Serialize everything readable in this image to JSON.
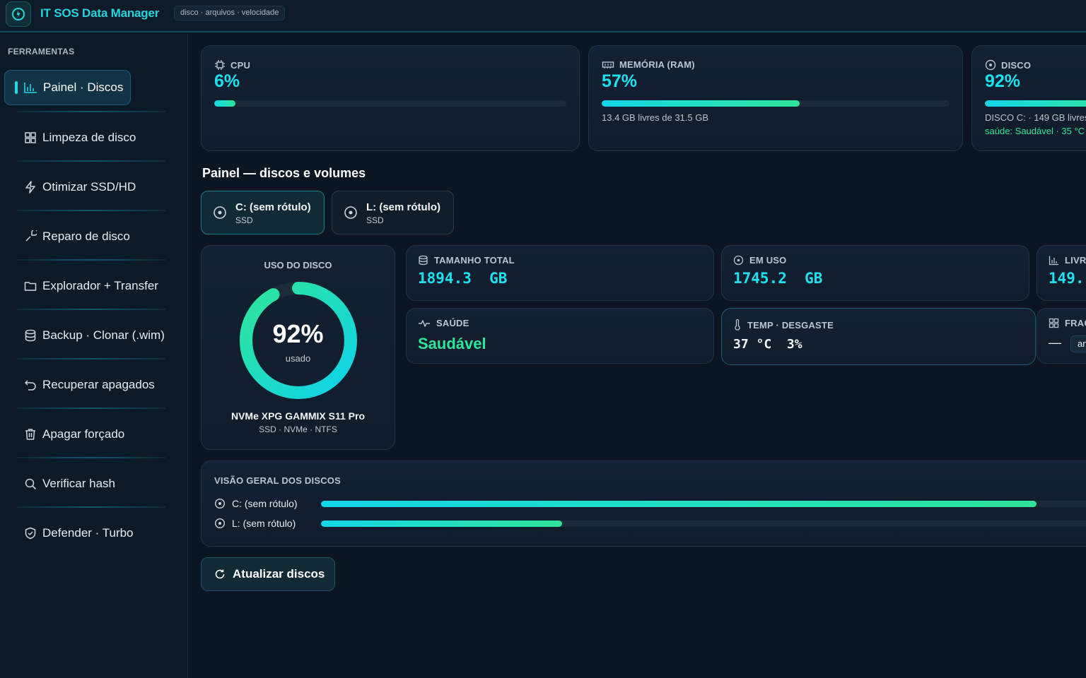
{
  "app": {
    "title": "IT SOS Data Manager",
    "tagline": "disco · arquivos · velocidade"
  },
  "sidebar": {
    "section_title": "FERRAMENTAS",
    "items": [
      {
        "label": "Painel · Discos",
        "icon": "bar-chart-icon",
        "active": true
      },
      {
        "label": "Limpeza de disco",
        "icon": "grid-icon"
      },
      {
        "label": "Otimizar SSD/HD",
        "icon": "lightning-icon"
      },
      {
        "label": "Reparo de disco",
        "icon": "wrench-icon"
      },
      {
        "label": "Explorador + Transfer",
        "icon": "folder-icon"
      },
      {
        "label": "Backup · Clonar (.wim)",
        "icon": "database-icon"
      },
      {
        "label": "Recuperar apagados",
        "icon": "undo-icon"
      },
      {
        "label": "Apagar forçado",
        "icon": "trash-icon"
      },
      {
        "label": "Verificar hash",
        "icon": "search-icon"
      },
      {
        "label": "Defender · Turbo",
        "icon": "shield-icon"
      }
    ]
  },
  "metrics": {
    "cpu": {
      "label": "CPU",
      "value": "6%",
      "percent": 6
    },
    "ram": {
      "label": "MEMÓRIA (RAM)",
      "value": "57%",
      "percent": 57,
      "sub": "13.4 GB livres de 31.5 GB"
    },
    "disk": {
      "label": "DISCO",
      "value": "92%",
      "percent": 92,
      "sub": "DISCO C: · 149 GB livres",
      "health": "saúde: Saudável · 35 °C"
    }
  },
  "section_title": "Painel — discos e volumes",
  "volumes": [
    {
      "name": "C:  (sem rótulo)",
      "type": "SSD",
      "selected": true
    },
    {
      "name": "L:  (sem rótulo)",
      "type": "SSD",
      "selected": false
    }
  ],
  "usage": {
    "title": "USO DO DISCO",
    "percent_label": "92%",
    "percent": 92,
    "used_label": "usado",
    "model": "NVMe XPG GAMMIX S11 Pro",
    "details": "SSD · NVMe · NTFS"
  },
  "stats": {
    "total": {
      "label": "TAMANHO TOTAL",
      "value": "1894.3  GB"
    },
    "used": {
      "label": "EM USO",
      "value": "1745.2  GB"
    },
    "free": {
      "label": "LIVR",
      "value": "149."
    },
    "health": {
      "label": "SAÚDE",
      "value": "Saudável"
    },
    "temp": {
      "label": "TEMP · DESGASTE",
      "value": "37 °C  3%"
    },
    "frag": {
      "label": "FRAG",
      "value": "—",
      "button": "an"
    }
  },
  "overview": {
    "title": "VISÃO GERAL DOS DISCOS",
    "rows": [
      {
        "label": "C:  (sem rótulo)",
        "percent": 92
      },
      {
        "label": "L:  (sem rótulo)",
        "percent": 31
      }
    ]
  },
  "actions": {
    "refresh": "Atualizar discos"
  },
  "colors": {
    "accent_cyan": "#1ee1ee",
    "accent_green": "#2ee59a",
    "background": "#0b1622",
    "card": "#122133"
  }
}
